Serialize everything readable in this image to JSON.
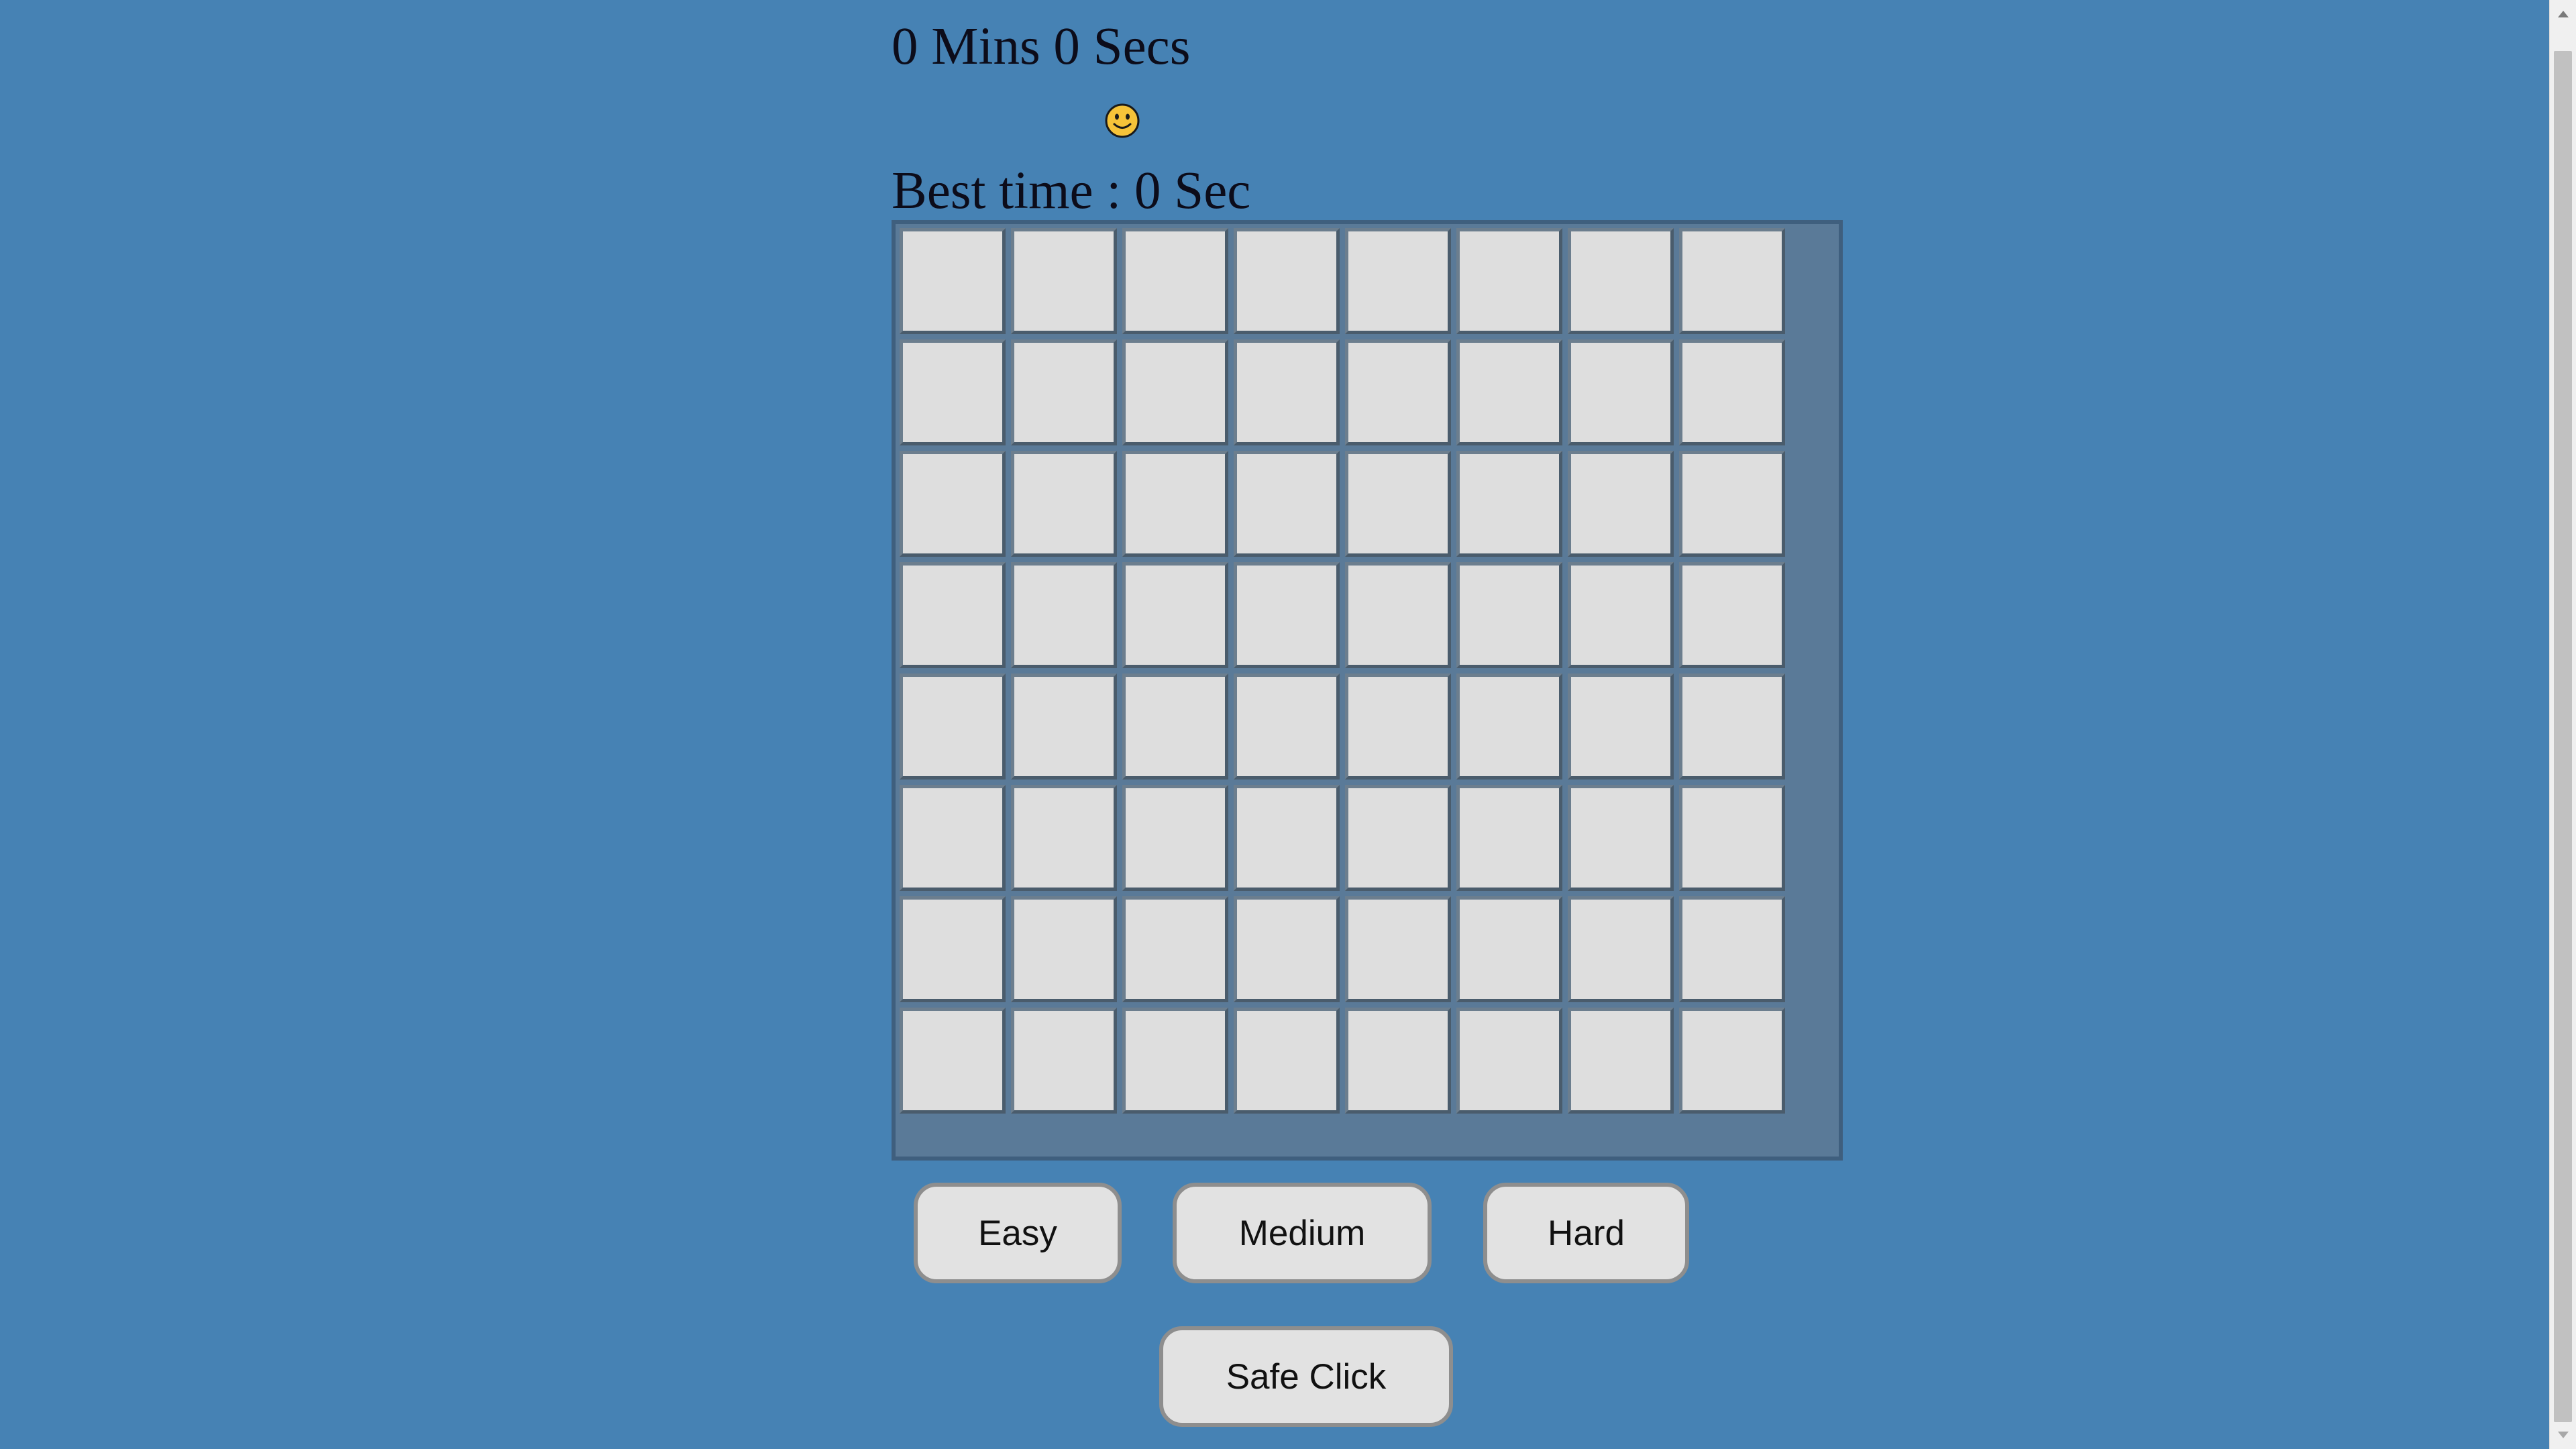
{
  "timer": {
    "text": "0 Mins 0 Secs"
  },
  "status": {
    "face_icon": "smiley-face-icon",
    "face_color": "#f6c339"
  },
  "best_time": {
    "text": "Best time : 0 Sec"
  },
  "board": {
    "rows": 8,
    "cols": 8,
    "cell_state": "unrevealed",
    "cell_color": "#dedede"
  },
  "difficulty": {
    "easy_label": "Easy",
    "medium_label": "Medium",
    "hard_label": "Hard"
  },
  "actions": {
    "safe_click_label": "Safe Click"
  },
  "colors": {
    "background": "#4682b4",
    "button_bg": "#e2e2e2",
    "button_border": "#8e8e8e"
  }
}
